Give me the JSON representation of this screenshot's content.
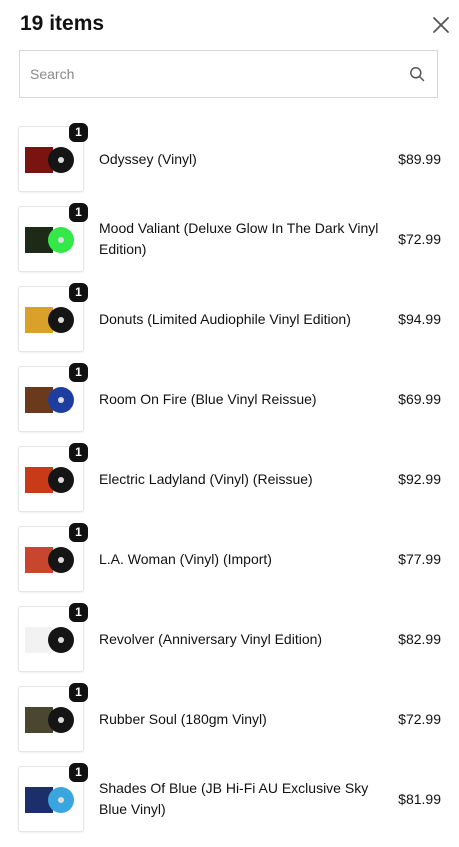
{
  "header": {
    "title": "19 items"
  },
  "search": {
    "placeholder": "Search",
    "value": ""
  },
  "items": [
    {
      "quantity": "1",
      "name": "Odyssey (Vinyl)",
      "price": "$89.99",
      "cover": "#7a1410",
      "disc": "#151515"
    },
    {
      "quantity": "1",
      "name": "Mood Valiant (Deluxe Glow In The Dark Vinyl Edition)",
      "price": "$72.99",
      "cover": "#1e2a18",
      "disc": "#35e84a"
    },
    {
      "quantity": "1",
      "name": "Donuts (Limited Audiophile Vinyl Edition)",
      "price": "$94.99",
      "cover": "#d9a12a",
      "disc": "#151515"
    },
    {
      "quantity": "1",
      "name": "Room On Fire (Blue Vinyl Reissue)",
      "price": "$69.99",
      "cover": "#6b3a1c",
      "disc": "#1d3e9e"
    },
    {
      "quantity": "1",
      "name": "Electric Ladyland (Vinyl) (Reissue)",
      "price": "$92.99",
      "cover": "#c83a18",
      "disc": "#151515"
    },
    {
      "quantity": "1",
      "name": "L.A. Woman (Vinyl) (Import)",
      "price": "$77.99",
      "cover": "#c8452e",
      "disc": "#151515"
    },
    {
      "quantity": "1",
      "name": "Revolver (Anniversary Vinyl Edition)",
      "price": "$82.99",
      "cover": "#f2f2f2",
      "disc": "#151515"
    },
    {
      "quantity": "1",
      "name": "Rubber Soul (180gm Vinyl)",
      "price": "$72.99",
      "cover": "#4a4630",
      "disc": "#151515"
    },
    {
      "quantity": "1",
      "name": "Shades Of Blue (JB Hi-Fi AU Exclusive Sky Blue Vinyl)",
      "price": "$81.99",
      "cover": "#1d2f6b",
      "disc": "#3aa6e0"
    }
  ]
}
